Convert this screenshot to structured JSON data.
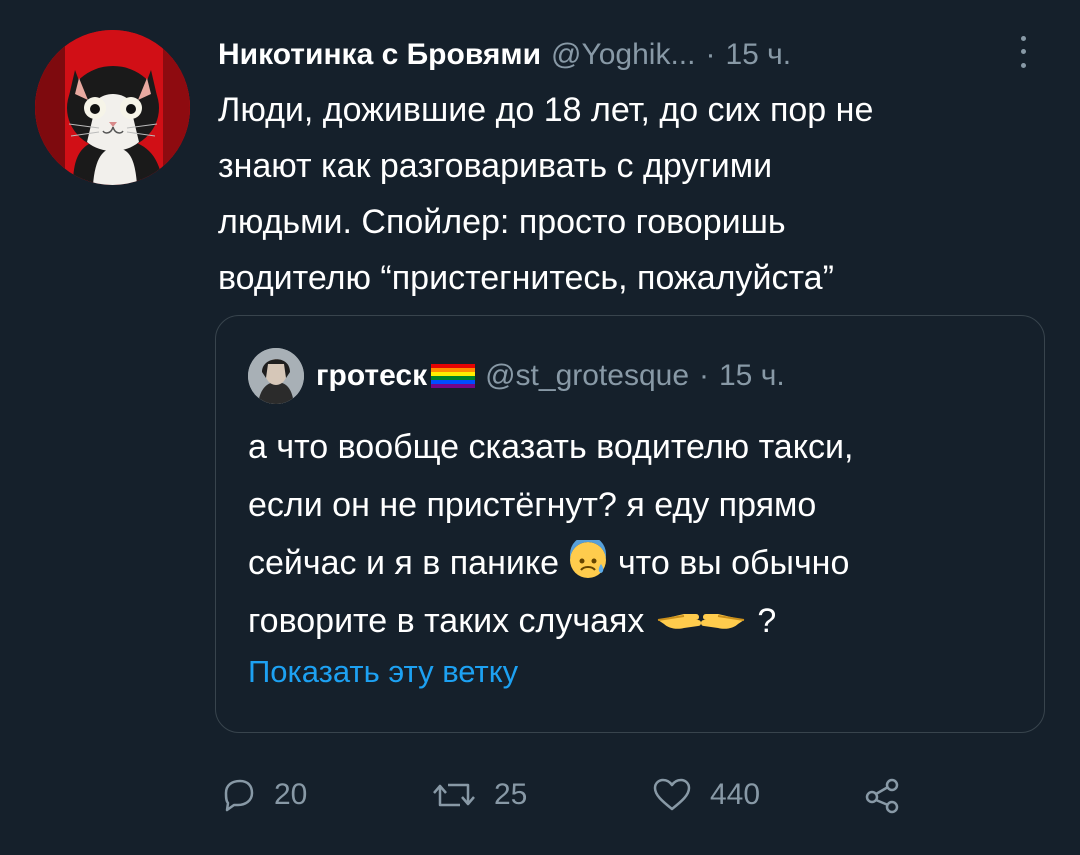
{
  "tweet": {
    "author_name": "Никотинка с Бровями",
    "author_handle": "@Yoghik...",
    "separator": "·",
    "time": "15 ч.",
    "lines": [
      "Люди, дожившие до 18 лет, до сих пор не",
      "знают как разговаривать с другими",
      "людьми. Спойлер: просто говоришь",
      "водителю “пристегнитесь, пожалуйста”"
    ]
  },
  "quote": {
    "author_name": "гротеск",
    "author_handle": "@st_grotesque",
    "separator": "·",
    "time": "15 ч.",
    "line1": "а что вообще сказать водителю такси,",
    "line2": "если он не пристёгнут? я еду прямо",
    "line3_before": "сейчас и я в панике",
    "line3_after": " что вы обычно",
    "line4_before": "говорите в таких случаях",
    "line4_after": "?",
    "show_thread": "Показать эту ветку"
  },
  "actions": {
    "reply_count": "20",
    "retweet_count": "25",
    "like_count": "440"
  },
  "icons": {
    "reply": "reply-icon",
    "retweet": "retweet-icon",
    "like": "heart-icon",
    "share": "share-icon",
    "more": "more-icon"
  },
  "colors": {
    "background": "#15202b",
    "secondary_text": "#8899a6",
    "link": "#1da1f2",
    "border": "#38444d"
  }
}
